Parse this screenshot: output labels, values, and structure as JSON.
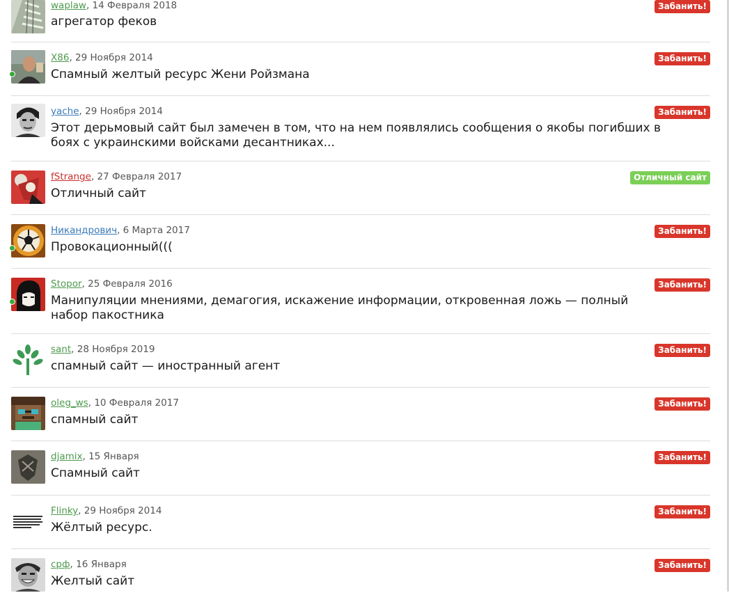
{
  "reviews": [
    {
      "user": "waplaw",
      "date": "14 Февраля 2018",
      "text": "агрегатор феков",
      "badge": "Забанить!",
      "badge_color": "#d9362b",
      "avatar": "building-photo",
      "online": false
    },
    {
      "user": "X86",
      "date": "29 Ноября 2014",
      "text": "Спамный желтый ресурс Жени Ройзмана",
      "badge": "Забанить!",
      "badge_color": "#d9362b",
      "avatar": "man-photo",
      "online": true
    },
    {
      "user": "yache",
      "date": "29 Ноября 2014",
      "text": "Этот дерьмовый сайт был замечен в том, что на нем появлялись сообщения о якобы погибших в боях с украинскими войсками десантниках...",
      "badge": "Забанить!",
      "badge_color": "#d9362b",
      "avatar": "bw-face-photo",
      "online": false
    },
    {
      "user": "fStrange",
      "date": "27 Февраля 2017",
      "text": "Отличный сайт",
      "badge": "Отличный сайт",
      "badge_color": "#7bcf57",
      "avatar": "red-art",
      "online": false
    },
    {
      "user": "Никандрович",
      "date": "6 Марта 2017",
      "text": "Провокационный(((",
      "badge": "Забанить!",
      "badge_color": "#d9362b",
      "avatar": "football",
      "online": true
    },
    {
      "user": "Stopor",
      "date": "25 Февраля 2016",
      "text": "Манипуляции мнениями, демагогия, искажение информации, откровенная ложь — полный набор пакостника",
      "badge": "Забанить!",
      "badge_color": "#d9362b",
      "avatar": "che-portrait",
      "online": true
    },
    {
      "user": "sant",
      "date": "28 Ноября 2019",
      "text": "спамный сайт — иностранный агент",
      "badge": "Забанить!",
      "badge_color": "#d9362b",
      "avatar": "tree-logo",
      "online": false
    },
    {
      "user": "oleg_ws",
      "date": "10 Февраля 2017",
      "text": "спамный сайт",
      "badge": "Забанить!",
      "badge_color": "#d9362b",
      "avatar": "pixel-character",
      "online": false
    },
    {
      "user": "djamix",
      "date": "15 Января",
      "text": "Спамный сайт",
      "badge": "Забанить!",
      "badge_color": "#d9362b",
      "avatar": "dark-emblem",
      "online": false
    },
    {
      "user": "Flinky",
      "date": "29 Ноября 2014",
      "text": "Жёлтый ресурс.",
      "badge": "Забанить!",
      "badge_color": "#d9362b",
      "avatar": "text-image",
      "online": false
    },
    {
      "user": "срф",
      "date": "16 Января",
      "text": "Желтый сайт",
      "badge": "Забанить!",
      "badge_color": "#d9362b",
      "avatar": "grinning-man-photo",
      "online": false
    }
  ],
  "colors": {
    "username_green": "#4e9a4e",
    "username_blue": "#3a7ab8",
    "username_red": "#c9302c",
    "ban_badge": "#d9362b",
    "good_badge": "#7bcf57",
    "online_dot": "#3aaa3a"
  }
}
